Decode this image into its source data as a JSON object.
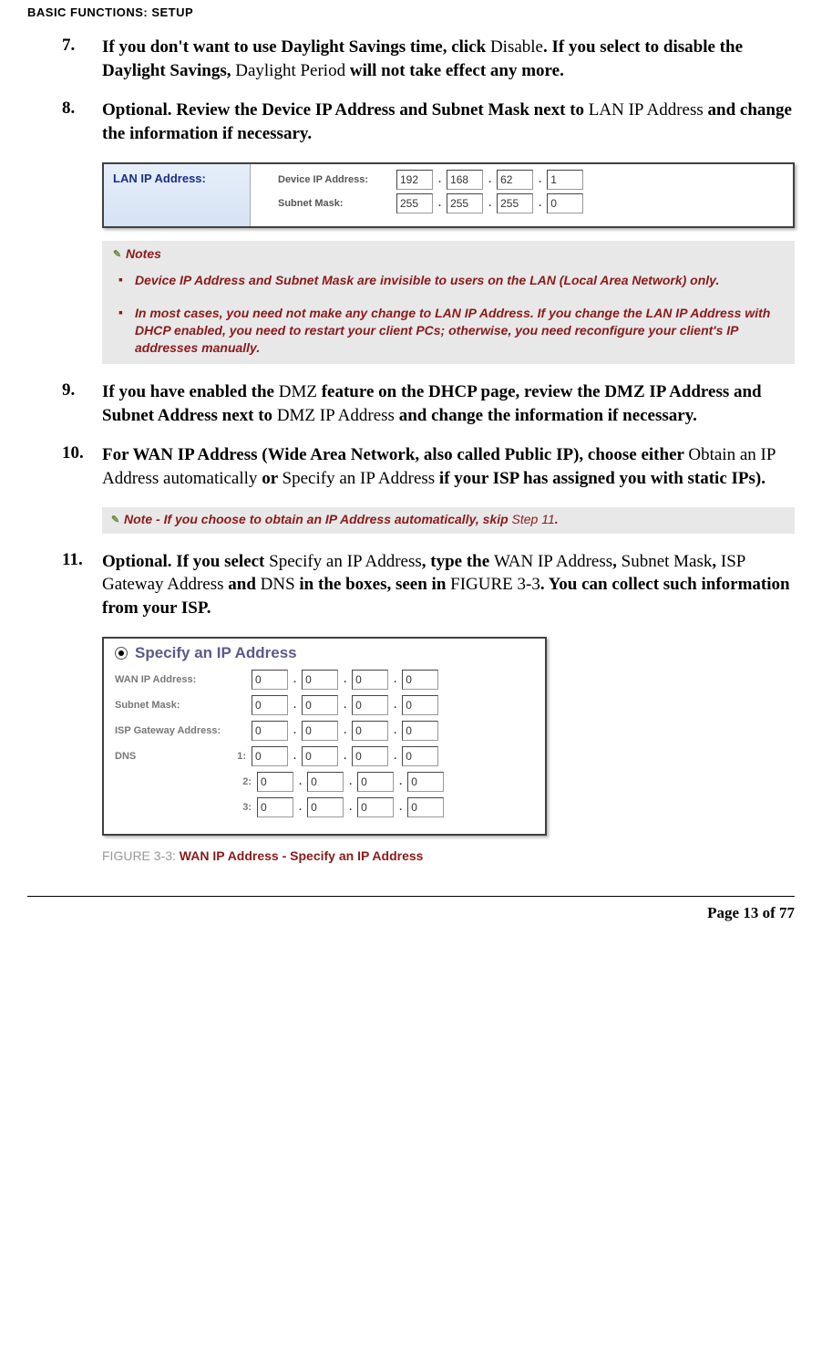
{
  "header": "BASIC FUNCTIONS: SETUP",
  "steps": {
    "s7": {
      "num": "7.",
      "b1": "If you don't want to use Daylight Savings time, click ",
      "p1": "Disable",
      "b2": ". If you select to disable the Daylight Savings, ",
      "p2": "Daylight Period",
      "b3": " will not take effect any more."
    },
    "s8": {
      "num": "8.",
      "b1": "Optional. Review the Device IP Address and Subnet Mask next to ",
      "p1": "LAN IP Address",
      "b2": " and change the information if necessary."
    },
    "s9": {
      "num": "9.",
      "b1": "If you have enabled the ",
      "p1": "DMZ",
      "b2": " feature on the DHCP page, review the DMZ IP Address and Subnet Address next to ",
      "p2": "DMZ IP Address",
      "b3": " and change the information if necessary."
    },
    "s10": {
      "num": "10.",
      "b1": "For WAN IP Address (Wide Area Network, also called Public IP), choose either ",
      "p1": "Obtain an IP Address automatically",
      "b2": " or ",
      "p2": "Specify an IP Address",
      "b3": " if your ISP has assigned you with static IPs)."
    },
    "s11": {
      "num": "11.",
      "b1": "Optional. If you select ",
      "p1": "Specify an IP Address",
      "b2": ", type the ",
      "p2": "WAN IP Address",
      "b3": ", ",
      "p3": "Subnet Mask",
      "b4": ", ",
      "p4": "ISP Gateway Address",
      "b5": " and ",
      "p5": "DNS",
      "b6": " in the boxes, seen in ",
      "p6": "FIGURE 3-3",
      "b7": ". You can collect such information from your ISP."
    }
  },
  "lan_panel": {
    "title": "LAN IP Address:",
    "row1_label": "Device IP Address:",
    "row2_label": "Subnet Mask:",
    "ip": [
      "192",
      "168",
      "62",
      "1"
    ],
    "mask": [
      "255",
      "255",
      "255",
      "0"
    ]
  },
  "notes_block": {
    "title": "Notes",
    "item1_a": "Device IP Address",
    "item1_b": " and ",
    "item1_c": "Subnet Mask",
    "item1_d": " are invisible to users on the LAN (Local Area Network) only.",
    "item2": "In most cases, you need not make any change to LAN IP Address. If you change the LAN IP Address with DHCP enabled, you need to restart your client PCs; otherwise, you need reconfigure your client's IP addresses manually."
  },
  "note_line": {
    "label": "Note",
    "b1": " - If you choose to obtain an IP Address automatically, skip ",
    "plain": "Step 11",
    "b2": "."
  },
  "wan_panel": {
    "title": "Specify an IP Address",
    "rows": {
      "r1": "WAN IP Address:",
      "r2": "Subnet Mask:",
      "r3": "ISP Gateway Address:",
      "r4": "DNS",
      "idx1": "1:",
      "idx2": "2:",
      "idx3": "3:"
    },
    "zero": "0"
  },
  "figure": {
    "label": "FIGURE 3-3: ",
    "title": "WAN IP Address - Specify an IP Address"
  },
  "footer": "Page 13 of 77"
}
